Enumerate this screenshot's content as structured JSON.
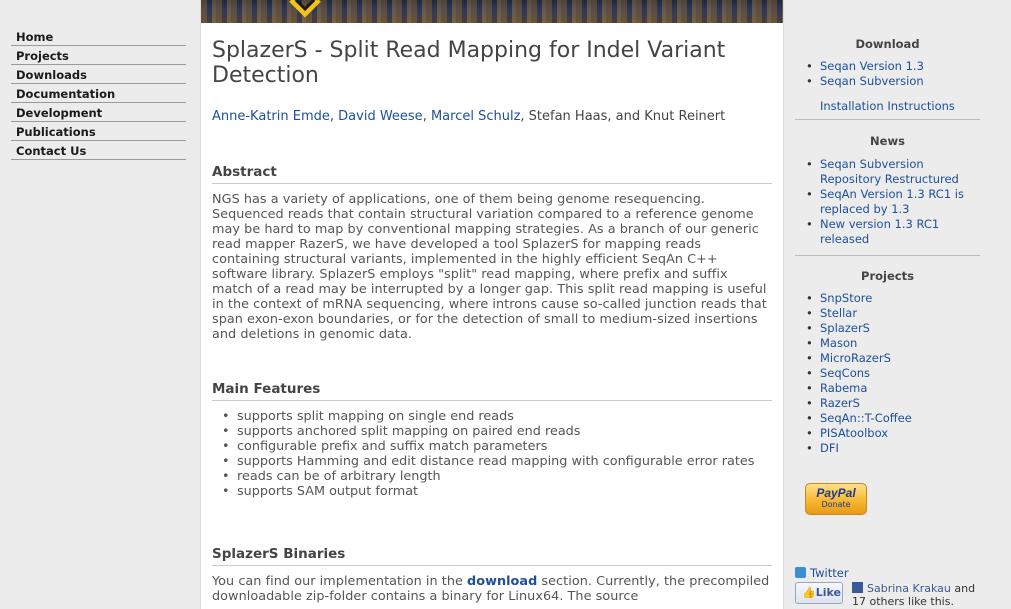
{
  "nav": {
    "items": [
      {
        "label": "Home"
      },
      {
        "label": "Projects"
      },
      {
        "label": "Downloads"
      },
      {
        "label": "Documentation"
      },
      {
        "label": "Development"
      },
      {
        "label": "Publications"
      },
      {
        "label": "Contact Us"
      }
    ]
  },
  "page": {
    "title": "SplazerS - Split Read Mapping for Indel Variant Detection",
    "authors": {
      "linked": [
        "Anne-Katrin Emde",
        "David Weese",
        "Marcel Schulz"
      ],
      "sep1": ", ",
      "sep2": ", ",
      "sep3": ", ",
      "rest": "Stefan Haas, and Knut Reinert"
    },
    "abstract": {
      "title": "Abstract",
      "text": "NGS has a variety of applications, one of them being genome resequencing. Sequenced reads that contain structural variation compared to a reference genome may be hard to map by conventional mapping strategies. As a branch of our generic read mapper RazerS, we have developed a tool SplazerS for mapping reads containing structural variants, implemented in the highly efficient SeqAn C++ software library. SplazerS employs \"split\" read mapping, where prefix and suffix match of a read may be interrupted by a longer gap. This split read mapping is useful in the context of mRNA sequencing, where introns cause so-called junction reads that span exon-exon boundaries, or for the detection of small to medium-sized insertions and deletions in genomic data."
    },
    "features": {
      "title": "Main Features",
      "items": [
        "supports split mapping on single end reads",
        "supports anchored split mapping on paired end reads",
        "configurable prefix and suffix match parameters",
        "supports Hamming and edit distance read mapping with configurable error rates",
        "reads can be of arbitrary length",
        "supports SAM output format"
      ]
    },
    "binaries": {
      "title": "SplazerS Binaries",
      "text_before": "You can find our implementation in the ",
      "link": "download",
      "text_after": " section. Currently, the precompiled downloadable zip-folder contains a binary for Linux64. The source"
    }
  },
  "sidebar": {
    "download": {
      "title": "Download",
      "items": [
        "Seqan Version 1.3",
        "Seqan Subversion"
      ],
      "install_link": "Installation Instructions"
    },
    "news": {
      "title": "News",
      "items": [
        "Seqan Subversion Repository Restructured",
        "SeqAn Version 1.3 RC1 is replaced by 1.3",
        "New version 1.3 RC1 released"
      ]
    },
    "projects": {
      "title": "Projects",
      "items": [
        "SnpStore",
        "Stellar",
        "SplazerS",
        "Mason",
        "MicroRazerS",
        "SeqCons",
        "Rabema",
        "RazerS",
        "SeqAn::T-Coffee",
        "PISAtoolbox",
        "DFI"
      ]
    },
    "paypal": {
      "brand": "PayPal",
      "label": "Donate"
    },
    "twitter": {
      "label": "Twitter"
    },
    "facebook": {
      "like_label": "Like",
      "name": "Sabrina Krakau",
      "text": " and 17 others like this."
    }
  },
  "colors": {
    "link": "#1d4f9a",
    "background": "#ececec",
    "facebook": "#3b5998",
    "paypal": "#f7b733"
  }
}
